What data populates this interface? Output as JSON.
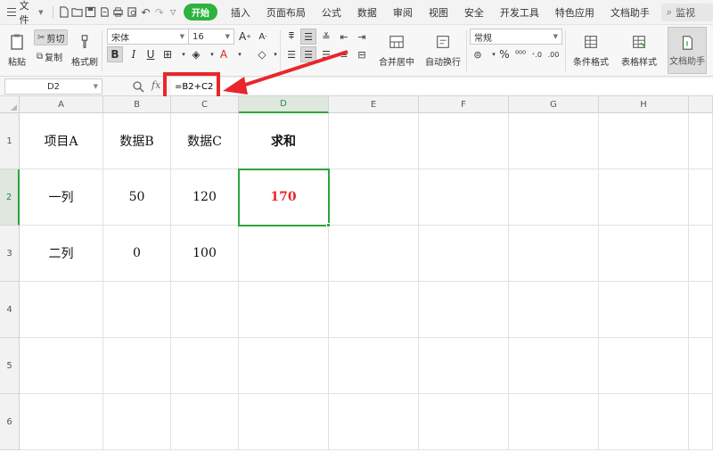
{
  "menubar": {
    "file_label": "文件",
    "tabs": [
      "开始",
      "插入",
      "页面布局",
      "公式",
      "数据",
      "审阅",
      "视图",
      "安全",
      "开发工具",
      "特色应用",
      "文档助手"
    ],
    "active_tab": "开始",
    "search_label": "监视"
  },
  "ribbon": {
    "paste_label": "粘贴",
    "cut_label": "剪切",
    "copy_label": "复制",
    "format_painter_label": "格式刷",
    "font_name": "宋体",
    "font_size": "16",
    "merge_center_label": "合并居中",
    "wrap_text_label": "自动换行",
    "number_format": "常规",
    "conditional_format_label": "条件格式",
    "table_style_label": "表格样式",
    "doc_helper_label": "文档助手"
  },
  "formula_bar": {
    "cell_ref": "D2",
    "fx_label": "fx",
    "formula": "=B2+C2"
  },
  "sheet": {
    "columns": [
      "A",
      "B",
      "C",
      "D",
      "E",
      "F",
      "G",
      "H"
    ],
    "rows": [
      "1",
      "2",
      "3",
      "4",
      "5",
      "6"
    ],
    "cells": [
      [
        "项目A",
        "数据B",
        "数据C",
        "求和",
        "",
        "",
        "",
        ""
      ],
      [
        "一列",
        "50",
        "120",
        "170",
        "",
        "",
        "",
        ""
      ],
      [
        "二列",
        "0",
        "100",
        "",
        "",
        "",
        "",
        ""
      ],
      [
        "",
        "",
        "",
        "",
        "",
        "",
        "",
        ""
      ],
      [
        "",
        "",
        "",
        "",
        "",
        "",
        "",
        ""
      ],
      [
        "",
        "",
        "",
        "",
        "",
        "",
        "",
        ""
      ]
    ],
    "selected_cell": "D2"
  },
  "colors": {
    "accent_green": "#2db33f",
    "annotation_red": "#e8262b",
    "selection_green": "#2da43b"
  }
}
